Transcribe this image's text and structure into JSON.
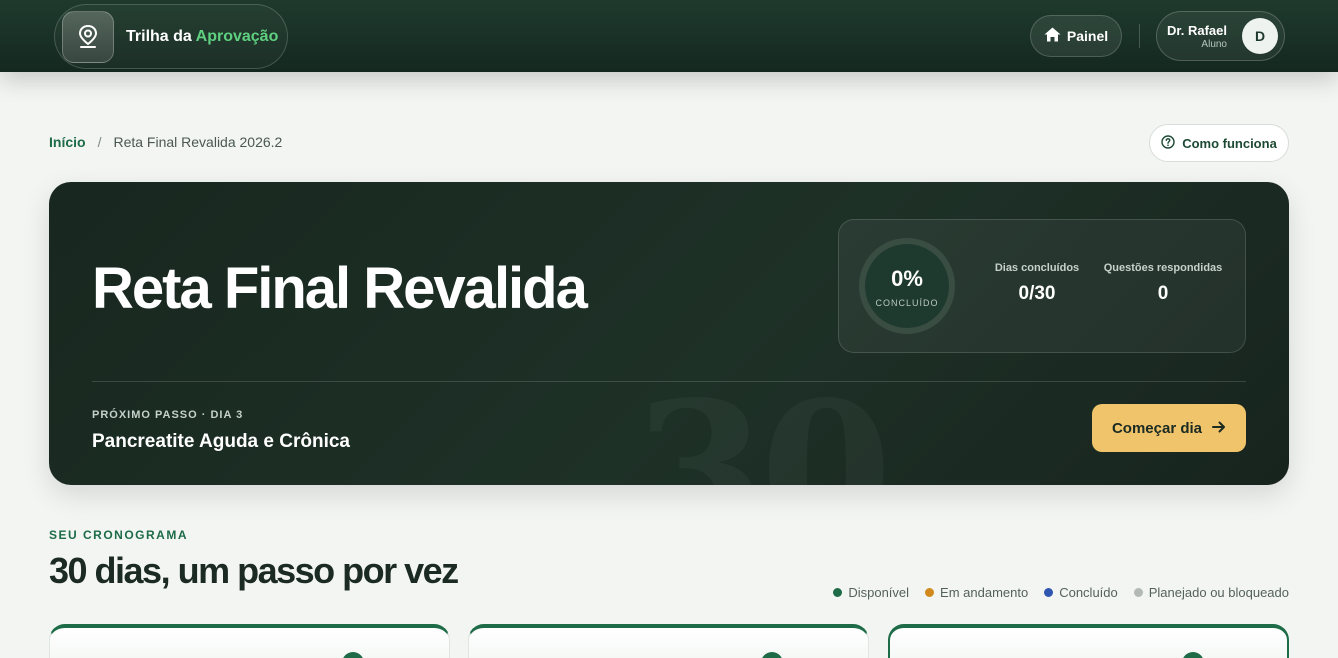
{
  "header": {
    "brand_prefix": "Trilha da",
    "brand_accent": "Aprovação",
    "brand_icon": "map-pin-icon",
    "painel_label": "Painel",
    "painel_icon": "home-icon",
    "user_name": "Dr. Rafael",
    "user_role": "Aluno",
    "avatar_initial": "D"
  },
  "breadcrumb": {
    "home": "Início",
    "separator": "/",
    "current": "Reta Final Revalida 2026.2"
  },
  "help_button": {
    "label": "Como funciona",
    "icon": "help-circle-icon"
  },
  "hero": {
    "title": "Reta Final Revalida",
    "watermark": "30",
    "progress_percent": "0%",
    "progress_label": "CONCLUÍDO",
    "progress_value": 0,
    "stats": [
      {
        "label": "Dias concluídos",
        "value": "0/30"
      },
      {
        "label": "Questões respondidas",
        "value": "0"
      }
    ],
    "next_label": "PRÓXIMO PASSO · DIA 3",
    "next_title": "Pancreatite Aguda e Crônica",
    "start_button": "Começar dia",
    "start_icon": "arrow-right-icon"
  },
  "schedule": {
    "kicker": "SEU CRONOGRAMA",
    "title": "30 dias, um passo por vez",
    "legend": [
      {
        "label": "Disponível",
        "color": "#1d6b47"
      },
      {
        "label": "Em andamento",
        "color": "#d08a1e"
      },
      {
        "label": "Concluído",
        "color": "#2f56b0"
      },
      {
        "label": "Planejado ou bloqueado",
        "color": "#b3b9b5"
      }
    ]
  },
  "colors": {
    "accent": "#1d6b47",
    "brand_green": "#5fd07f",
    "cta": "#f0c46a",
    "hero_bg": "#1b2b22"
  }
}
